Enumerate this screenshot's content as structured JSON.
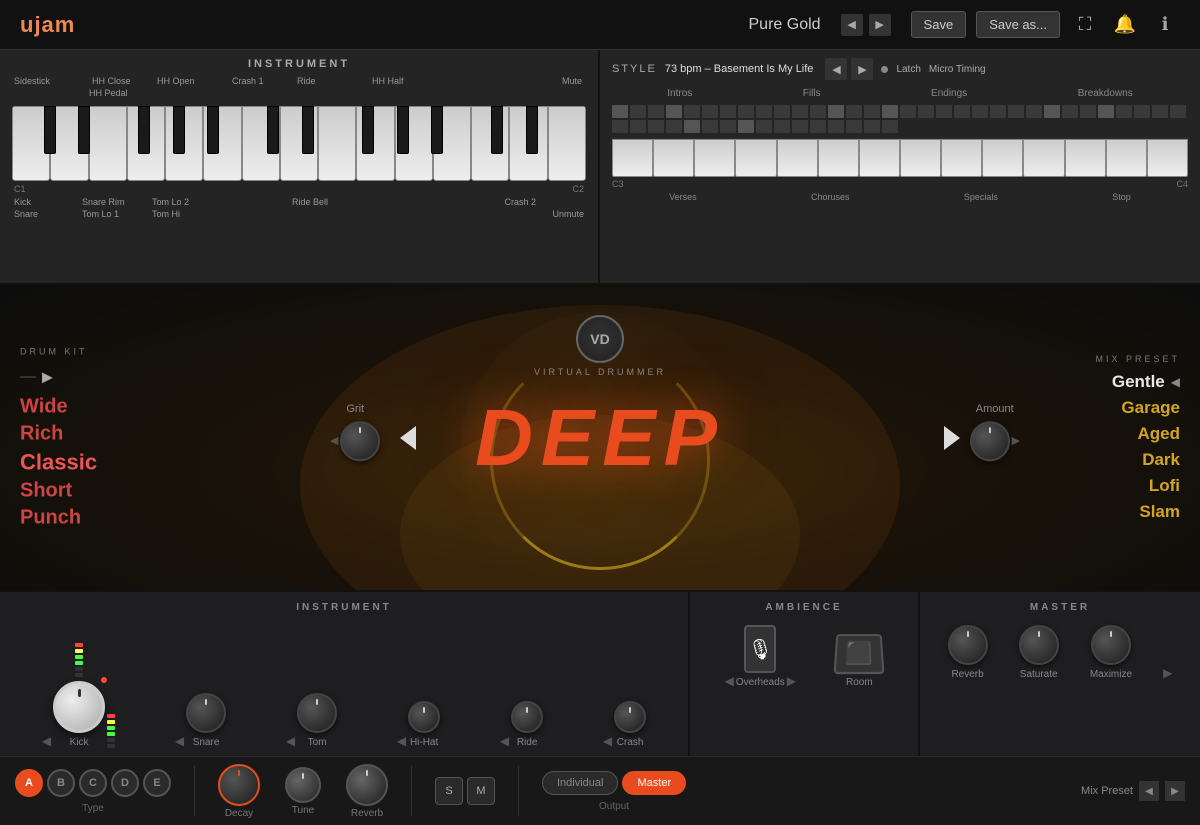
{
  "app": {
    "logo": "ujam",
    "preset_name": "Pure Gold",
    "nav_prev": "◀",
    "nav_next": "▶",
    "save_label": "Save",
    "save_as_label": "Save as...",
    "icon_fullscreen": "⛶",
    "icon_bell": "🔔",
    "icon_info": "ℹ"
  },
  "instrument_panel": {
    "title": "INSTRUMENT",
    "labels_top": [
      "Sidestick",
      "HH Close",
      "HH Pedal",
      "HH Open",
      "Crash 1",
      "Ride",
      "HH Half",
      "Mute"
    ],
    "labels_bottom_top": [
      "Kick",
      "Snare Rim",
      "Tom Lo 2",
      "Ride Bell",
      "Crash 2"
    ],
    "labels_bottom_bot": [
      "Snare",
      "Tom Lo 1",
      "Tom Hi",
      "",
      "Unmute"
    ],
    "oct_c1": "C1",
    "oct_c2": "C2"
  },
  "style_panel": {
    "title": "STYLE",
    "bpm": "73 bpm – Basement Is My Life",
    "latch": "Latch",
    "micro_timing": "Micro Timing",
    "categories": [
      "Intros",
      "Fills",
      "Endings",
      "Breakdowns"
    ],
    "sub_categories": [
      "Verses",
      "Choruses",
      "Specials",
      "Stop"
    ],
    "oct_c3": "C3",
    "oct_c4": "C4"
  },
  "drum_kit": {
    "label": "DRUM KIT",
    "items": [
      "Wide",
      "Rich",
      "Classic",
      "Short",
      "Punch"
    ],
    "selected": "Classic",
    "grit_label": "Grit",
    "amount_label": "Amount"
  },
  "deep_title": "DEEP",
  "vd_logo": "VD",
  "vd_subtitle": "VIRTUAL DRUMMER",
  "mix_preset": {
    "label": "MIX PRESET",
    "items": [
      "Gentle",
      "Garage",
      "Aged",
      "Dark",
      "Lofi",
      "Slam"
    ],
    "selected": "Gentle"
  },
  "bottom_instrument": {
    "title": "INSTRUMENT",
    "knobs": [
      {
        "label": "Kick",
        "size": "large",
        "color": "white"
      },
      {
        "label": "Snare",
        "size": "medium"
      },
      {
        "label": "Tom",
        "size": "medium"
      },
      {
        "label": "Hi-Hat",
        "size": "small"
      },
      {
        "label": "Ride",
        "size": "small"
      },
      {
        "label": "Crash",
        "size": "small"
      }
    ]
  },
  "bottom_ambience": {
    "title": "AMBIENCE",
    "items": [
      {
        "label": "Overheads",
        "icon": "mic"
      },
      {
        "label": "Room",
        "icon": "room"
      }
    ]
  },
  "bottom_master": {
    "title": "MASTER",
    "knobs": [
      {
        "label": "Reverb"
      },
      {
        "label": "Saturate"
      },
      {
        "label": "Maximize"
      }
    ]
  },
  "bottom_controls": {
    "type_buttons": [
      "A",
      "B",
      "C",
      "D",
      "E"
    ],
    "type_active": "A",
    "type_label": "Type",
    "decay_label": "Decay",
    "tune_label": "Tune",
    "reverb_label": "Reverb",
    "sm_buttons": [
      "S",
      "M"
    ],
    "output_label": "Output",
    "output_options": [
      "Individual",
      "Master"
    ],
    "output_active": "Master",
    "mix_preset_label": "Mix Preset"
  }
}
